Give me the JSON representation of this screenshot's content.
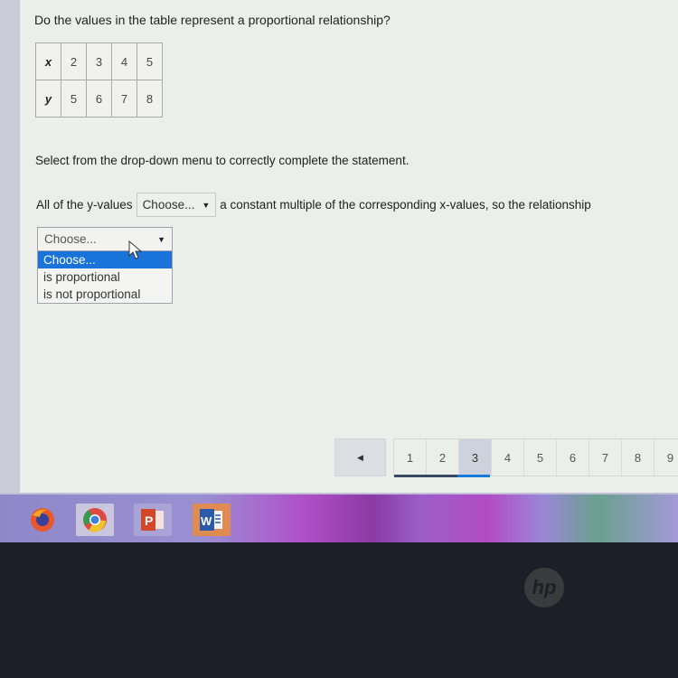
{
  "question": "Do the values in the table represent a proportional relationship?",
  "table": {
    "rows": [
      {
        "label": "x",
        "values": [
          "2",
          "3",
          "4",
          "5"
        ]
      },
      {
        "label": "y",
        "values": [
          "5",
          "6",
          "7",
          "8"
        ]
      }
    ]
  },
  "instruction": "Select from the drop-down menu to correctly complete the statement.",
  "statement": {
    "before": "All of the y-values",
    "select_value": "Choose...",
    "after": "a constant multiple of the corresponding x-values, so the relationship"
  },
  "dropdown": {
    "current": "Choose...",
    "options": [
      "Choose...",
      "is proportional",
      "is not proportional"
    ],
    "highlighted_index": 0
  },
  "pager": {
    "prev_icon": "left-triangle-icon",
    "pages": [
      "1",
      "2",
      "3",
      "4",
      "5",
      "6",
      "7",
      "8",
      "9"
    ],
    "active": "3"
  },
  "taskbar": {
    "apps": [
      "firefox",
      "chrome",
      "powerpoint",
      "word"
    ]
  },
  "bezel": {
    "logo": "hp"
  }
}
